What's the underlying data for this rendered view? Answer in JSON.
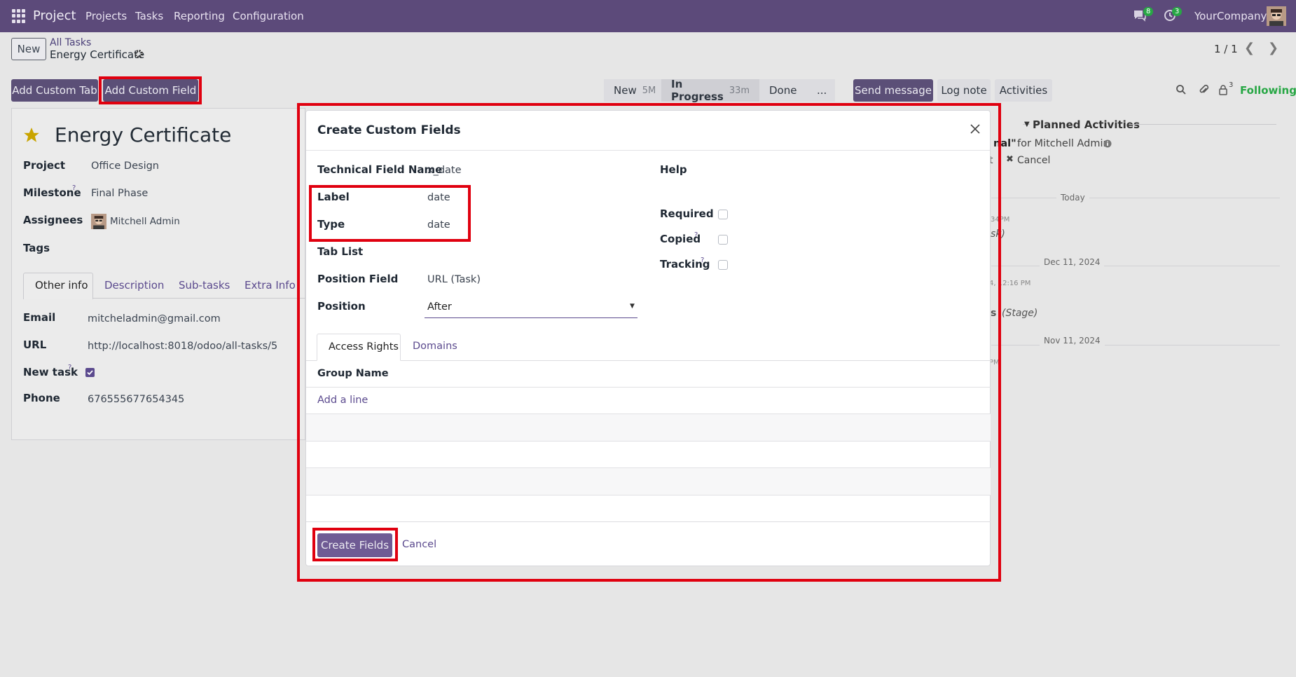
{
  "navbar": {
    "app_name": "Project",
    "menu": [
      "Projects",
      "Tasks",
      "Reporting",
      "Configuration"
    ],
    "messages_badge": "8",
    "activities_badge": "3",
    "company": "YourCompany"
  },
  "control": {
    "new_button": "New",
    "breadcrumb_parent": "All Tasks",
    "breadcrumb_current": "Energy Certificate",
    "pager": "1 / 1"
  },
  "toolbar": {
    "add_custom_tab": "Add Custom Tab",
    "add_custom_field": "Add Custom Field"
  },
  "stages": [
    {
      "label": "New",
      "time": "5M"
    },
    {
      "label": "In Progress",
      "time": "33m"
    },
    {
      "label": "Done",
      "time": ""
    },
    {
      "label": "...",
      "time": ""
    }
  ],
  "chatter": {
    "send_message": "Send message",
    "log_note": "Log note",
    "activities": "Activities",
    "followers_count": "3",
    "following": "Following",
    "planned_activities": "Planned Activities",
    "activity_title_fragment": "nal\"",
    "activity_for": "for Mitchell Admin",
    "activity_edit_fragment": "t",
    "cancel": "Cancel",
    "date_today": "Today",
    "time1": "34PM",
    "note1_fragment": "sk)",
    "date_dec": "Dec 11, 2024",
    "time2": "4, 12:16 PM",
    "note2_fragment": "s",
    "note2_stage": "(Stage)",
    "date_nov": "Nov 11, 2024",
    "time3": "PM"
  },
  "task": {
    "title": "Energy Certificate",
    "project_label": "Project",
    "project_value": "Office Design",
    "milestone_label": "Milestone",
    "milestone_value": "Final Phase",
    "assignees_label": "Assignees",
    "assignees_value": "Mitchell Admin",
    "tags_label": "Tags",
    "tabs": [
      "Other info",
      "Description",
      "Sub-tasks",
      "Extra Info"
    ],
    "email_label": "Email",
    "email_value": "mitcheladmin@gmail.com",
    "url_label": "URL",
    "url_value": "http://localhost:8018/odoo/all-tasks/5",
    "newtask_label": "New task",
    "phone_label": "Phone",
    "phone_value": "676555677654345"
  },
  "dialog": {
    "title": "Create Custom Fields",
    "technical_name_label": "Technical Field Name",
    "technical_name_value": "x_date",
    "label_label": "Label",
    "label_value": "date",
    "type_label": "Type",
    "type_value": "date",
    "tab_list_label": "Tab List",
    "position_field_label": "Position Field",
    "position_field_value": "URL (Task)",
    "position_label": "Position",
    "position_value": "After",
    "help_label": "Help",
    "required_label": "Required",
    "copied_label": "Copied",
    "tracking_label": "Tracking",
    "tabs": [
      "Access Rights",
      "Domains"
    ],
    "group_name_header": "Group Name",
    "add_line": "Add a line",
    "create_button": "Create Fields",
    "cancel_button": "Cancel"
  },
  "colors": {
    "navbar": "#5c4a7a",
    "primary": "#5b4f77",
    "highlight": "#e0000f",
    "following": "#28a745"
  }
}
